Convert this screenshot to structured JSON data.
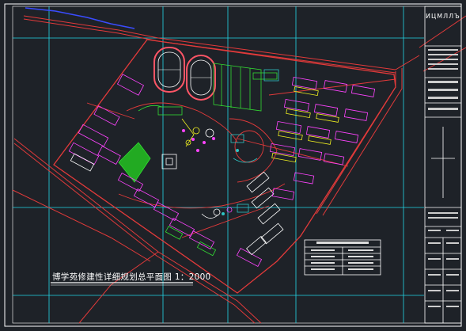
{
  "drawing": {
    "title": "博学苑修建性详细规划总平面图 1：2000",
    "title_block_logo": "ИЦМЛЛЪ"
  },
  "colors": {
    "background": "#1e2228",
    "frame": "#ffffff",
    "grid_axis": "#22d6e6",
    "road": "#e23a3a",
    "building": "#ff44ff",
    "vegetation": "#33dd33",
    "water": "#2ec4c4",
    "plot_line": "#e0e060",
    "track": "#ff5566"
  },
  "layers": [
    "title-block",
    "site-boundary",
    "roads",
    "buildings",
    "sports-field",
    "vegetation",
    "axis-grid",
    "legend-table"
  ]
}
